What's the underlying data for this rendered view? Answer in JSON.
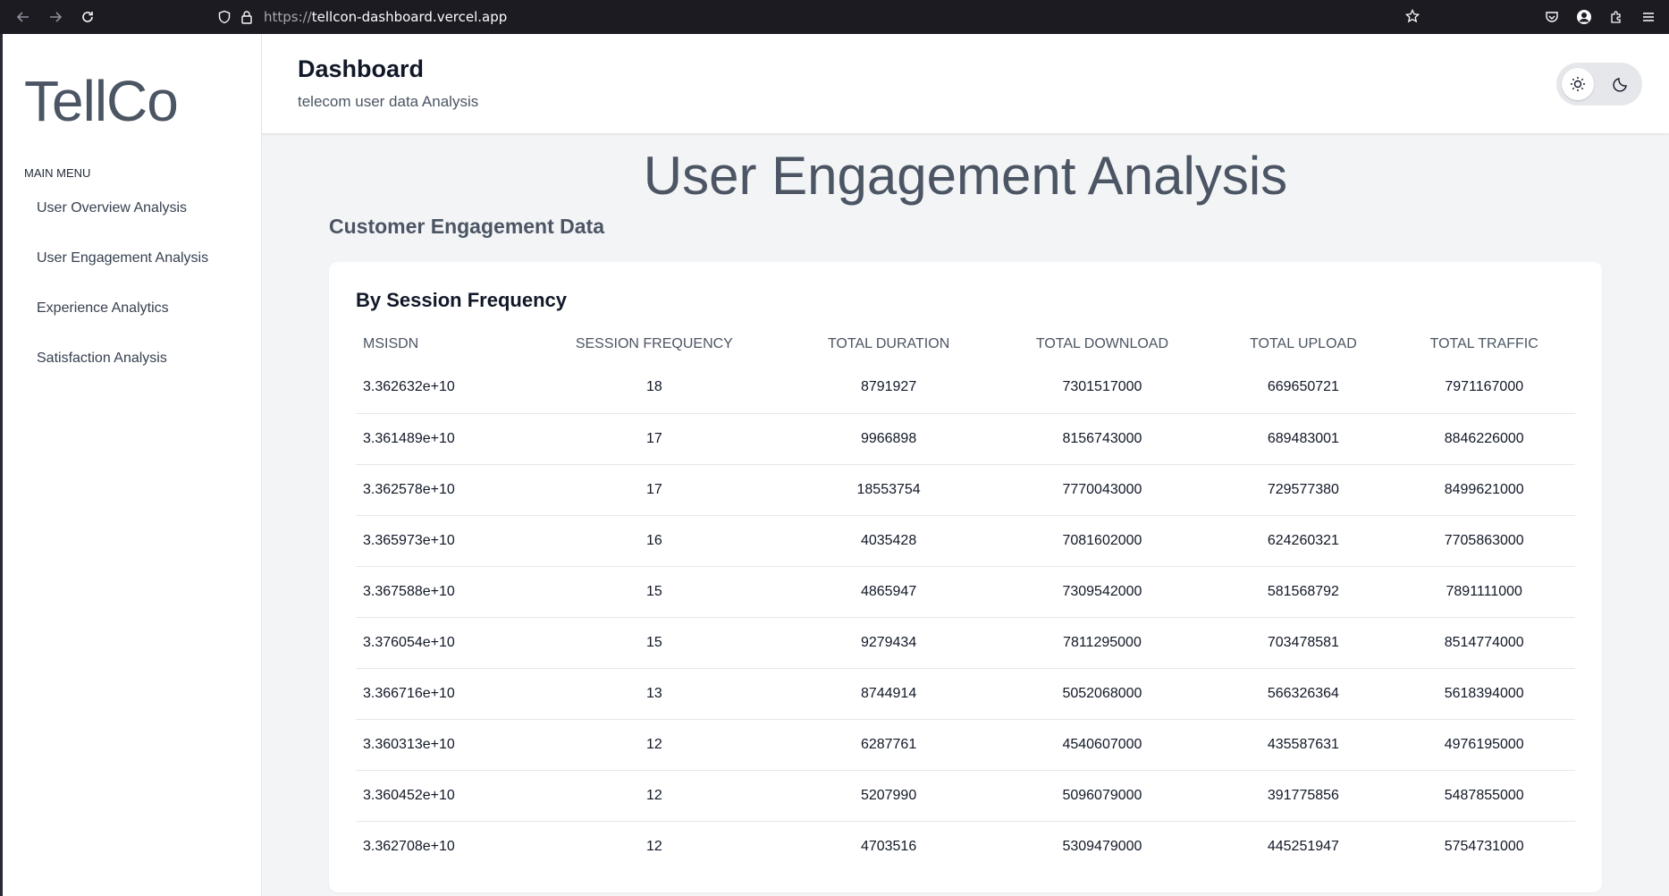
{
  "browser": {
    "url_protocol": "https://",
    "url_host": "tellcon-dashboard.vercel.app"
  },
  "sidebar": {
    "logo": "TellCo",
    "menu_heading": "MAIN MENU",
    "items": [
      {
        "label": "User Overview Analysis"
      },
      {
        "label": "User Engagement Analysis"
      },
      {
        "label": "Experience Analytics"
      },
      {
        "label": "Satisfaction Analysis"
      }
    ]
  },
  "header": {
    "title": "Dashboard",
    "subtitle": "telecom user data Analysis",
    "theme": "light"
  },
  "main": {
    "section_title": "User Engagement Analysis",
    "section_subtitle": "Customer Engagement Data",
    "card": {
      "title": "By Session Frequency",
      "columns": [
        "MSISDN",
        "SESSION FREQUENCY",
        "TOTAL DURATION",
        "TOTAL DOWNLOAD",
        "TOTAL UPLOAD",
        "TOTAL TRAFFIC"
      ],
      "rows": [
        [
          "3.362632e+10",
          "18",
          "8791927",
          "7301517000",
          "669650721",
          "7971167000"
        ],
        [
          "3.361489e+10",
          "17",
          "9966898",
          "8156743000",
          "689483001",
          "8846226000"
        ],
        [
          "3.362578e+10",
          "17",
          "18553754",
          "7770043000",
          "729577380",
          "8499621000"
        ],
        [
          "3.365973e+10",
          "16",
          "4035428",
          "7081602000",
          "624260321",
          "7705863000"
        ],
        [
          "3.367588e+10",
          "15",
          "4865947",
          "7309542000",
          "581568792",
          "7891111000"
        ],
        [
          "3.376054e+10",
          "15",
          "9279434",
          "7811295000",
          "703478581",
          "8514774000"
        ],
        [
          "3.366716e+10",
          "13",
          "8744914",
          "5052068000",
          "566326364",
          "5618394000"
        ],
        [
          "3.360313e+10",
          "12",
          "6287761",
          "4540607000",
          "435587631",
          "4976195000"
        ],
        [
          "3.360452e+10",
          "12",
          "5207990",
          "5096079000",
          "391775856",
          "5487855000"
        ],
        [
          "3.362708e+10",
          "12",
          "4703516",
          "5309479000",
          "445251947",
          "5754731000"
        ]
      ]
    }
  }
}
